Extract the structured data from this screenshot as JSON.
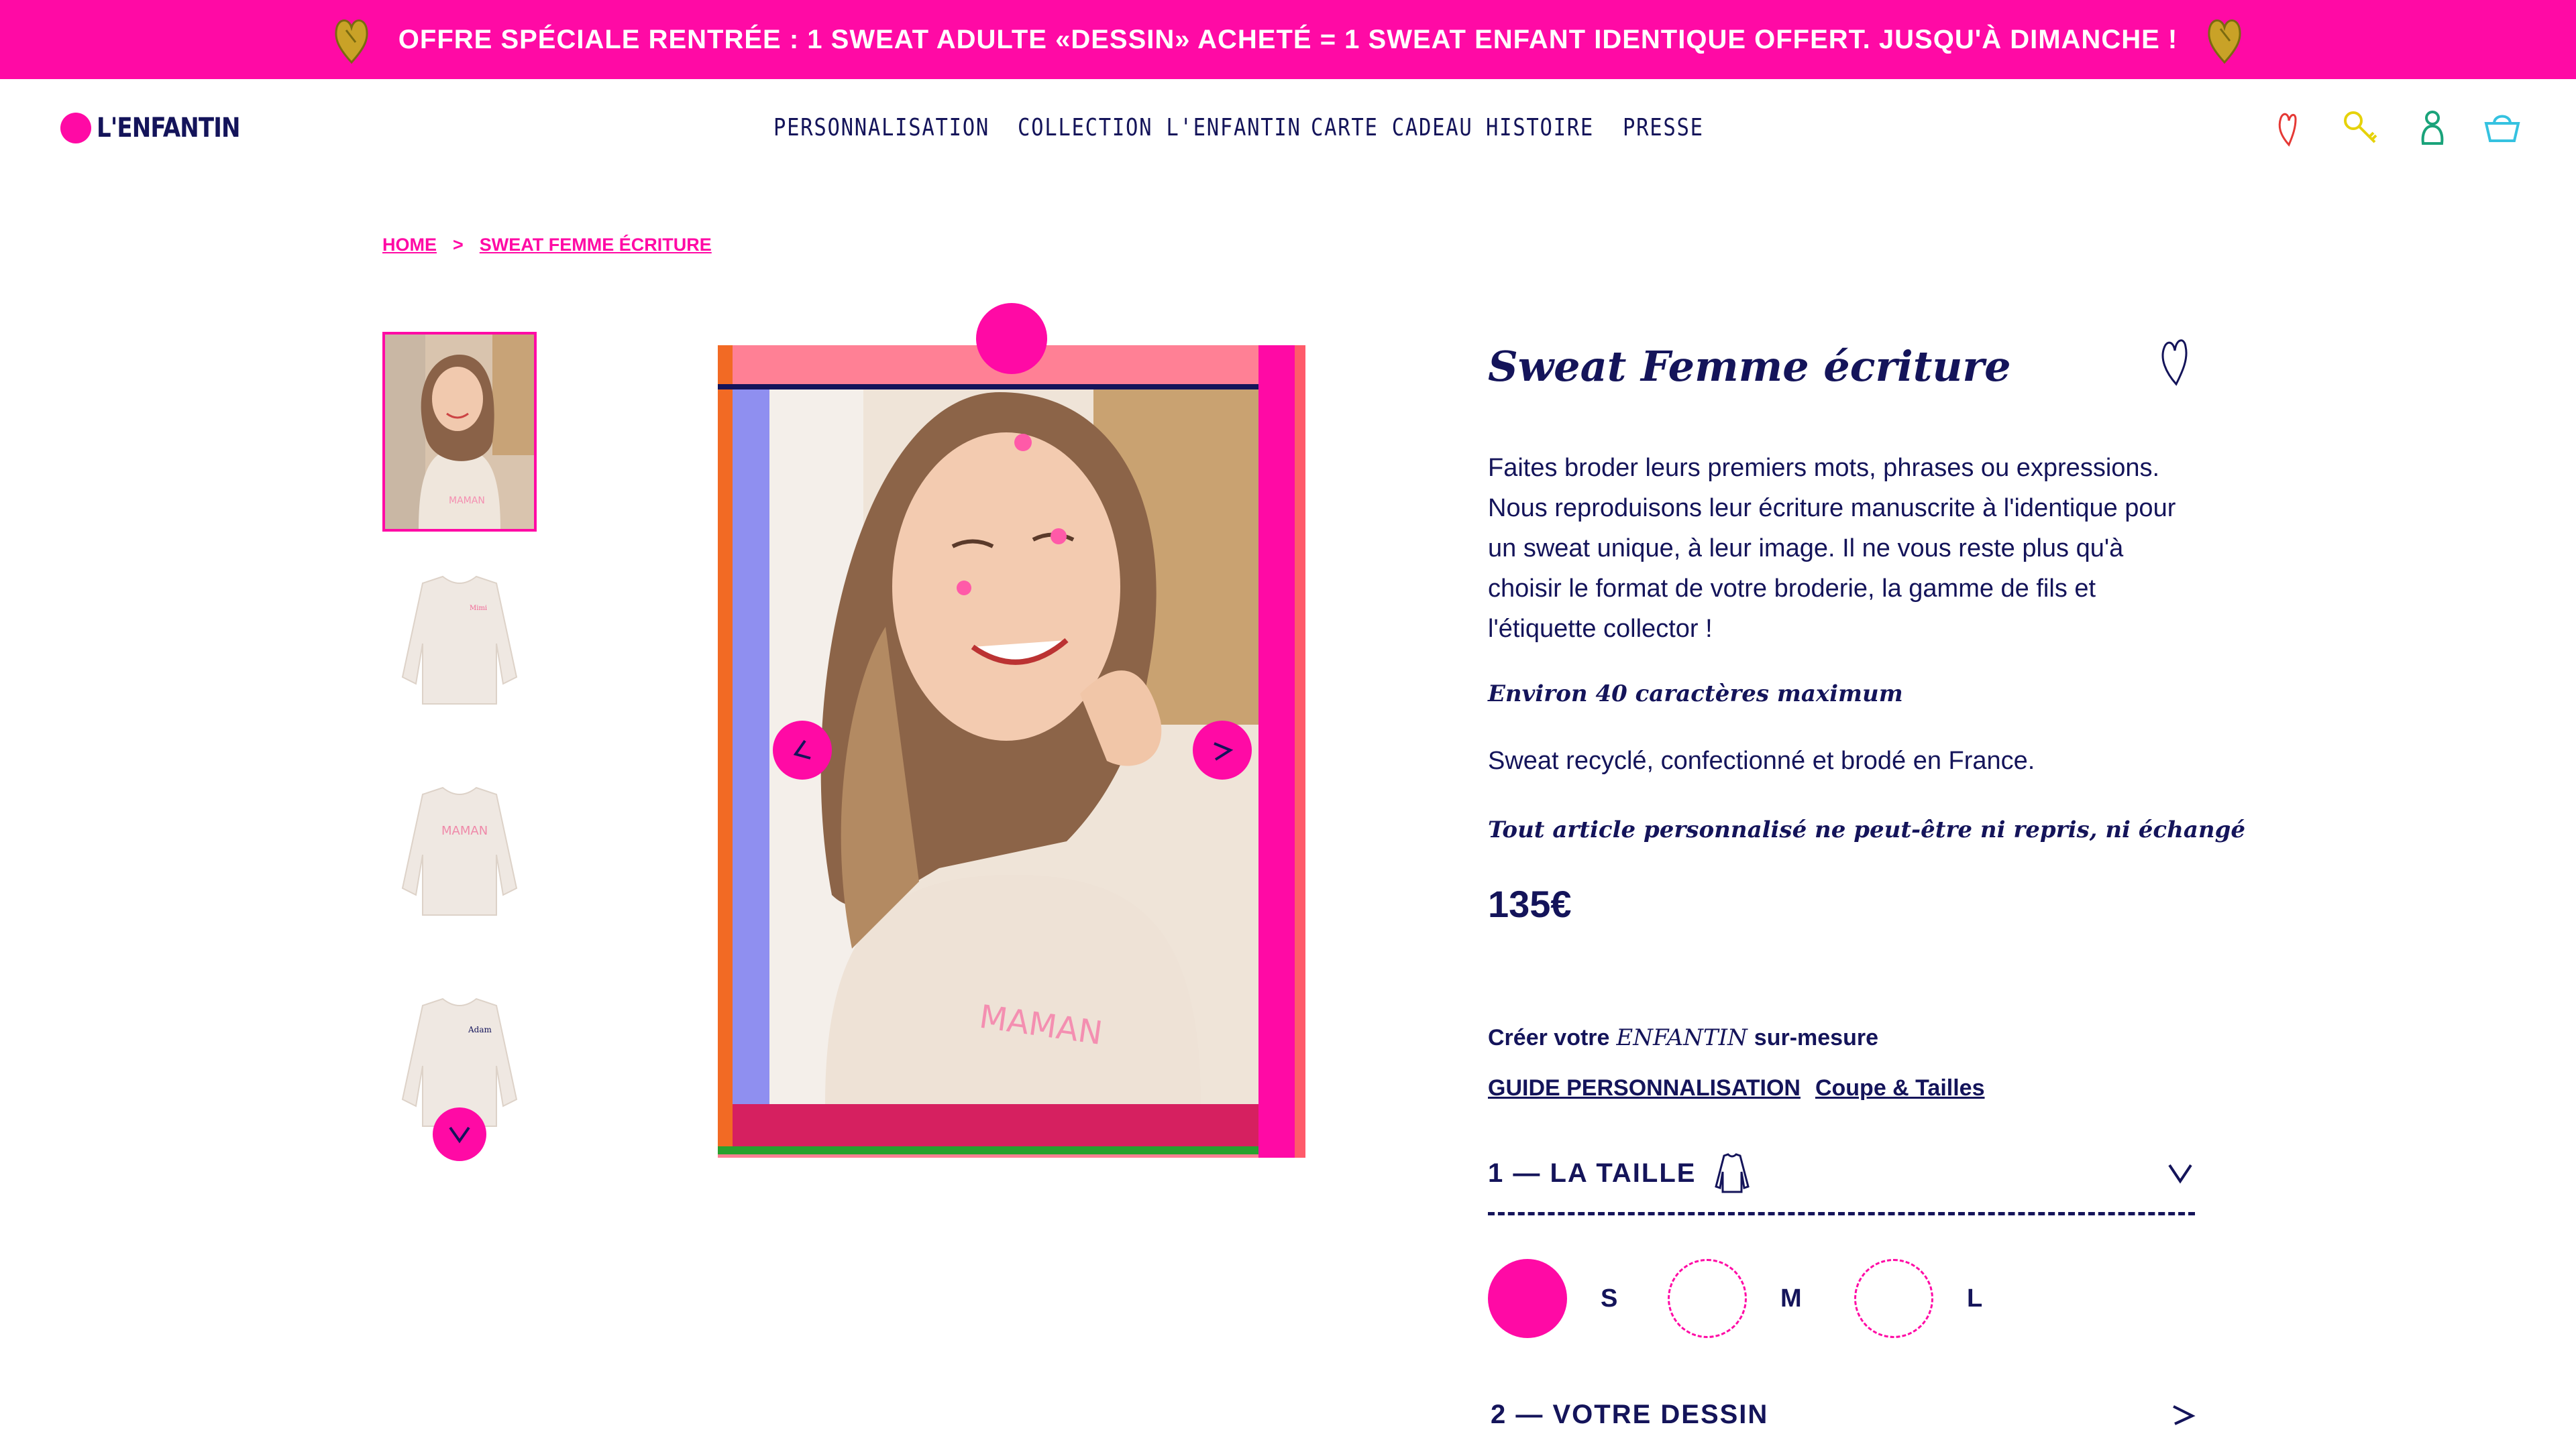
{
  "promo": {
    "text": "OFFRE SPÉCIALE RENTRÉE : 1 SWEAT ADULTE «DESSIN» ACHETÉ = 1 SWEAT ENFANT IDENTIQUE OFFERT. JUSQU'À DIMANCHE !",
    "background_color": "#ff0aa5",
    "heart_icon_color": "#c9a227"
  },
  "header": {
    "logo_text": "L'ENFANTIN",
    "nav": [
      "PERSONNALISATION",
      "COLLECTION L'ENFANTIN",
      "CARTE CADEAU",
      "HISTOIRE",
      "PRESSE"
    ],
    "icons": [
      "heart-icon",
      "search-key-icon",
      "account-icon",
      "basket-icon"
    ]
  },
  "breadcrumb": {
    "home": "HOME",
    "separator": ">",
    "current": "SWEAT FEMME ÉCRITURE"
  },
  "gallery": {
    "thumbnails": [
      "model-photo",
      "sweat-front",
      "sweat-pink-writing",
      "sweat-chest-writing"
    ],
    "selected_index": 0,
    "embroidery_text": "MAMAN"
  },
  "product": {
    "title": "Sweat Femme écriture",
    "description": "Faites broder leurs premiers mots, phrases ou expressions. Nous reproduisons leur écriture manuscrite à l'identique pour un sweat unique, à leur image. Il ne vous reste plus qu'à choisir le format de votre broderie, la gamme de fils et l'étiquette collector !",
    "note_characters": "Environ 40 caractères maximum",
    "made_in": "Sweat recyclé, confectionné et brodé en France.",
    "note_personalized": "Tout article personnalisé ne peut-être ni repris, ni échangé",
    "price": "135€"
  },
  "customize": {
    "prefix": "Créer votre",
    "brand": "ENFANTIN",
    "suffix": "sur-mesure",
    "guide_link": "GUIDE PERSONNALISATION",
    "sizes_link": "Coupe & Tailles"
  },
  "steps": [
    {
      "label": "1 — LA TAILLE",
      "expanded": true
    },
    {
      "label": "2 — VOTRE DESSIN",
      "expanded": false
    }
  ],
  "sizes": [
    {
      "label": "S",
      "selected": true
    },
    {
      "label": "M",
      "selected": false
    },
    {
      "label": "L",
      "selected": false
    }
  ],
  "colors": {
    "accent": "#ff0aa5",
    "navy": "#14145a"
  }
}
